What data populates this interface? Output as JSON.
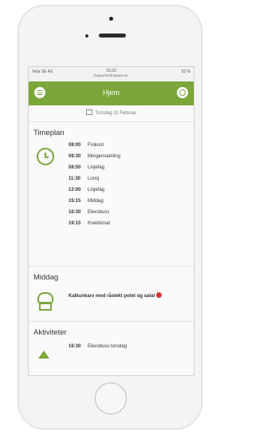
{
  "status_bar": {
    "carrier": "Telia SE 4G",
    "time": "23:23",
    "url": "hvaperfor.finspace.se",
    "battery": "53 %"
  },
  "nav": {
    "title": "Hjem",
    "menu_icon": "menu-icon",
    "home_icon": "settings-icon",
    "accent_color": "#7aa63a"
  },
  "date_label": "Torsdag 11 Februar",
  "timeplan": {
    "title": "Timeplan",
    "icon": "clock-icon",
    "rows": [
      {
        "time": "08:00",
        "label": "Frokost"
      },
      {
        "time": "08:30",
        "label": "Morgensamling"
      },
      {
        "time": "08:50",
        "label": "Linjefag"
      },
      {
        "time": "11:30",
        "label": "Lunsj"
      },
      {
        "time": "12:00",
        "label": "Linjefag"
      },
      {
        "time": "15:15",
        "label": "Middag"
      },
      {
        "time": "16:30",
        "label": "Elevsbuss"
      },
      {
        "time": "19:15",
        "label": "Kveldsmat"
      }
    ]
  },
  "middag": {
    "title": "Middag",
    "icon": "chef-hat-icon",
    "text": "Kalkunkarv med råstekt potet og salat"
  },
  "aktiviteter": {
    "title": "Aktiviteter",
    "icon": "triangle-icon",
    "time": "16:30",
    "label": "Elevsbuss torsdag"
  }
}
